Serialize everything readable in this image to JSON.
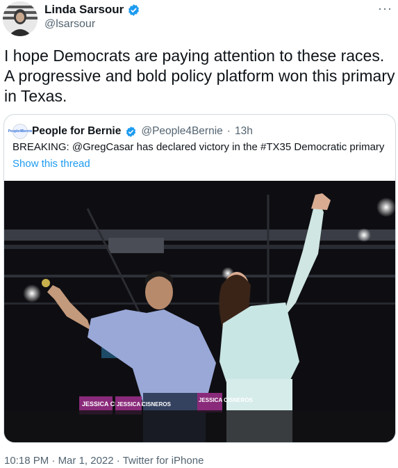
{
  "author": {
    "name": "Linda Sarsour",
    "handle": "@lsarsour"
  },
  "tweet": {
    "text": "I hope Democrats are paying attention to these races. A progressive and bold policy platform won this primary in Texas."
  },
  "more_label": "···",
  "quoted": {
    "avatar_text": "People4Bernie",
    "name": "People for Bernie",
    "handle": "@People4Bernie",
    "separator": "·",
    "time": "13h",
    "text": "BREAKING: @GregCasar has declared victory in the #TX35 Democratic primary",
    "thread_link": "Show this thread",
    "photo": {
      "signs": [
        "JESSICA CISNEROS",
        "JESSICA CISNEROS",
        "JESSICA CISNEROS"
      ]
    }
  },
  "footer": {
    "time": "10:18 PM",
    "date": "Mar 1, 2022",
    "source": "Twitter for iPhone",
    "sep": "·"
  },
  "colors": {
    "link": "#1d9bf0",
    "verified": "#1d9bf0",
    "secondary_text": "#536471",
    "border": "#cfd9de"
  }
}
